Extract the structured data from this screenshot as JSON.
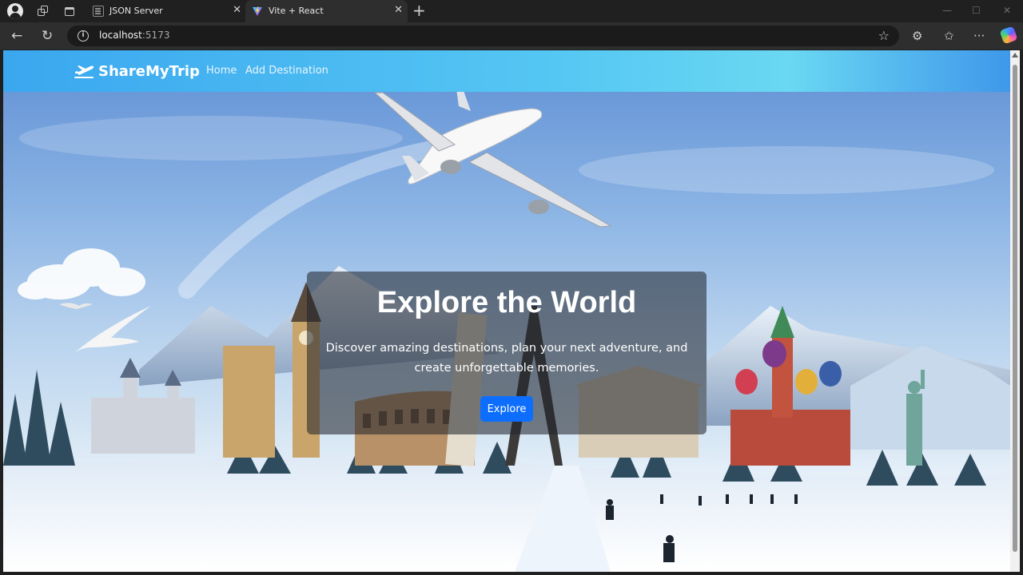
{
  "browser": {
    "tabs": [
      {
        "title": "JSON Server",
        "close": "✕"
      },
      {
        "title": "Vite + React",
        "close": "✕"
      }
    ],
    "new_tab": "+",
    "window_controls": {
      "minimize": "—",
      "maximize": "☐",
      "close": "✕"
    },
    "url_host": "localhost",
    "url_port": ":5173"
  },
  "navbar": {
    "brand": "ShareMyTrip",
    "links": [
      "Home",
      "Add Destination"
    ]
  },
  "hero": {
    "title": "Explore the World",
    "subtitle": "Discover amazing destinations, plan your next adventure, and create unforgettable memories.",
    "button": "Explore"
  },
  "colors": {
    "primary_button": "#0d6efd",
    "navbar_start": "#3aa7ef",
    "navbar_end": "#3f98ea"
  }
}
